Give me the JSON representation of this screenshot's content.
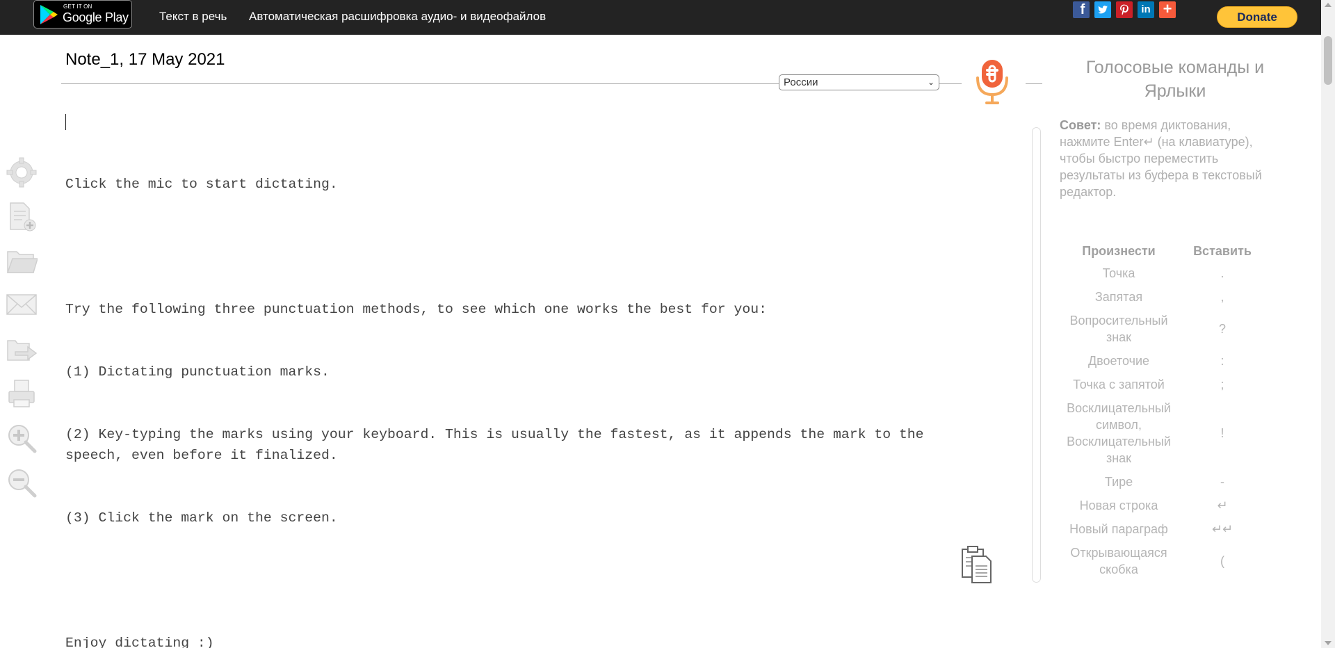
{
  "topbar": {
    "google_play": {
      "small": "GET IT ON",
      "big": "Google Play"
    },
    "nav": [
      {
        "label": "Текст в речь"
      },
      {
        "label": "Автоматическая расшифровка аудио- и видеофайлов"
      }
    ],
    "share": {
      "fb": "f",
      "twitter": "t",
      "pinterest": "P",
      "linkedin": "in",
      "more": "+"
    },
    "donate_label": "Donate"
  },
  "note": {
    "title": "Note_1, 17 May 2021",
    "language": "России"
  },
  "editor": {
    "lines": [
      "Click the mic to start dictating.",
      "",
      "Try the following three punctuation methods, to see which one works the best for you:",
      "(1) Dictating punctuation marks.",
      "(2) Key-typing the marks using your keyboard. This is usually the fastest, as it appends the mark to the speech, even before it finalized.",
      "(3) Click the mark on the screen.",
      "",
      "Enjoy dictating :)"
    ]
  },
  "panel": {
    "title": "Голосовые команды и Ярлыки",
    "tip_label": "Совет:",
    "tip_text": " во время диктования, нажмите Enter↵ (на клавиатуре), чтобы быстро переместить результаты из буфера в текстовый редактор.",
    "headers": {
      "say": "Произнести",
      "insert": "Вставить"
    },
    "commands": [
      {
        "say": "Точка",
        "insert": "."
      },
      {
        "say": "Запятая",
        "insert": ","
      },
      {
        "say": "Вопросительный знак",
        "insert": "?"
      },
      {
        "say": "Двоеточие",
        "insert": ":"
      },
      {
        "say": "Точка с запятой",
        "insert": ";"
      },
      {
        "say": "Восклицательный символ, Восклицательный знак",
        "insert": "!"
      },
      {
        "say": "Тире",
        "insert": "-"
      },
      {
        "say": "Новая строка",
        "insert": "↵"
      },
      {
        "say": "Новый параграф",
        "insert": "↵↵"
      },
      {
        "say": "Открывающаяся скобка",
        "insert": "("
      }
    ]
  },
  "colors": {
    "topbar": "#232323",
    "donate": "#ffc439",
    "mic": "#f0643c",
    "panel_text": "#b0b0b0"
  },
  "icons": {
    "toolbar": [
      "gear-icon",
      "new-document-icon",
      "folder-icon",
      "envelope-icon",
      "export-icon",
      "printer-icon",
      "zoom-in-icon",
      "zoom-out-icon"
    ],
    "mic": "microphone-icon",
    "copy": "copy-clipboard-icon"
  }
}
